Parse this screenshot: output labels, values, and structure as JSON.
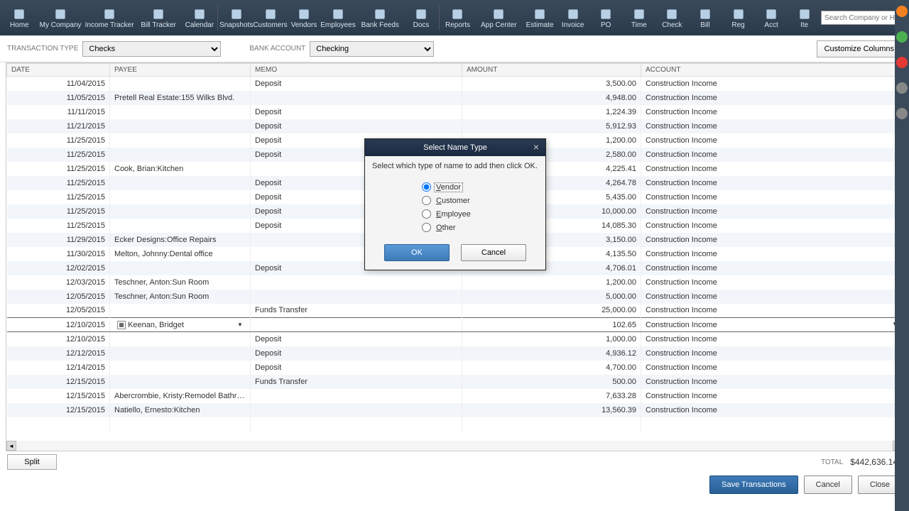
{
  "toolbar": {
    "items": [
      "Home",
      "My Company",
      "Income Tracker",
      "Bill Tracker",
      "Calendar",
      "Snapshots",
      "Customers",
      "Vendors",
      "Employees",
      "Bank Feeds",
      "Docs",
      "Reports",
      "App Center",
      "Estimate",
      "Invoice",
      "PO",
      "Time",
      "Check",
      "Bill",
      "Reg",
      "Acct",
      "Ite"
    ],
    "search_placeholder": "Search Company or Help"
  },
  "filters": {
    "tx_type_label": "TRANSACTION TYPE",
    "tx_type_value": "Checks",
    "bank_label": "BANK ACCOUNT",
    "bank_value": "Checking",
    "customize_cols": "Customize Columns"
  },
  "columns": {
    "date": "DATE",
    "payee": "PAYEE",
    "memo": "MEMO",
    "amount": "AMOUNT",
    "account": "ACCOUNT"
  },
  "rows": [
    {
      "date": "11/04/2015",
      "payee": "",
      "memo": "Deposit",
      "amount": "3,500.00",
      "account": "Construction Income"
    },
    {
      "date": "11/05/2015",
      "payee": "Pretell Real Estate:155 Wilks Blvd.",
      "memo": "",
      "amount": "4,948.00",
      "account": "Construction Income"
    },
    {
      "date": "11/11/2015",
      "payee": "",
      "memo": "Deposit",
      "amount": "1,224.39",
      "account": "Construction Income"
    },
    {
      "date": "11/21/2015",
      "payee": "",
      "memo": "Deposit",
      "amount": "5,912.93",
      "account": "Construction Income"
    },
    {
      "date": "11/25/2015",
      "payee": "",
      "memo": "Deposit",
      "amount": "1,200.00",
      "account": "Construction Income"
    },
    {
      "date": "11/25/2015",
      "payee": "",
      "memo": "Deposit",
      "amount": "2,580.00",
      "account": "Construction Income"
    },
    {
      "date": "11/25/2015",
      "payee": "Cook, Brian:Kitchen",
      "memo": "",
      "amount": "4,225.41",
      "account": "Construction Income"
    },
    {
      "date": "11/25/2015",
      "payee": "",
      "memo": "Deposit",
      "amount": "4,264.78",
      "account": "Construction Income"
    },
    {
      "date": "11/25/2015",
      "payee": "",
      "memo": "Deposit",
      "amount": "5,435.00",
      "account": "Construction Income"
    },
    {
      "date": "11/25/2015",
      "payee": "",
      "memo": "Deposit",
      "amount": "10,000.00",
      "account": "Construction Income"
    },
    {
      "date": "11/25/2015",
      "payee": "",
      "memo": "Deposit",
      "amount": "14,085.30",
      "account": "Construction Income"
    },
    {
      "date": "11/29/2015",
      "payee": "Ecker Designs:Office Repairs",
      "memo": "",
      "amount": "3,150.00",
      "account": "Construction Income"
    },
    {
      "date": "11/30/2015",
      "payee": "Melton, Johnny:Dental office",
      "memo": "",
      "amount": "4,135.50",
      "account": "Construction Income"
    },
    {
      "date": "12/02/2015",
      "payee": "",
      "memo": "Deposit",
      "amount": "4,706.01",
      "account": "Construction Income"
    },
    {
      "date": "12/03/2015",
      "payee": "Teschner, Anton:Sun Room",
      "memo": "",
      "amount": "1,200.00",
      "account": "Construction Income"
    },
    {
      "date": "12/05/2015",
      "payee": "Teschner, Anton:Sun Room",
      "memo": "",
      "amount": "5,000.00",
      "account": "Construction Income"
    },
    {
      "date": "12/05/2015",
      "payee": "",
      "memo": "Funds Transfer",
      "amount": "25,000.00",
      "account": "Construction Income"
    },
    {
      "date": "12/10/2015",
      "payee": "Keenan, Bridget",
      "memo": "",
      "amount": "102.65",
      "account": "Construction Income",
      "selected": true
    },
    {
      "date": "12/10/2015",
      "payee": "",
      "memo": "Deposit",
      "amount": "1,000.00",
      "account": "Construction Income"
    },
    {
      "date": "12/12/2015",
      "payee": "",
      "memo": "Deposit",
      "amount": "4,936.12",
      "account": "Construction Income"
    },
    {
      "date": "12/14/2015",
      "payee": "",
      "memo": "Deposit",
      "amount": "4,700.00",
      "account": "Construction Income"
    },
    {
      "date": "12/15/2015",
      "payee": "",
      "memo": "Funds Transfer",
      "amount": "500.00",
      "account": "Construction Income"
    },
    {
      "date": "12/15/2015",
      "payee": "Abercrombie, Kristy:Remodel Bathroo...",
      "memo": "",
      "amount": "7,633.28",
      "account": "Construction Income"
    },
    {
      "date": "12/15/2015",
      "payee": "Natiello, Ernesto:Kitchen",
      "memo": "",
      "amount": "13,560.39",
      "account": "Construction Income"
    },
    {
      "date": "",
      "payee": "",
      "memo": "",
      "amount": "",
      "account": ""
    }
  ],
  "footer": {
    "split": "Split",
    "total_label": "TOTAL",
    "total_value": "$442,636.14",
    "save": "Save Transactions",
    "cancel": "Cancel",
    "close": "Close"
  },
  "dialog": {
    "title": "Select Name Type",
    "message": "Select which type of name to add then click OK.",
    "options": [
      "Vendor",
      "Customer",
      "Employee",
      "Other"
    ],
    "ok": "OK",
    "cancel": "Cancel"
  }
}
